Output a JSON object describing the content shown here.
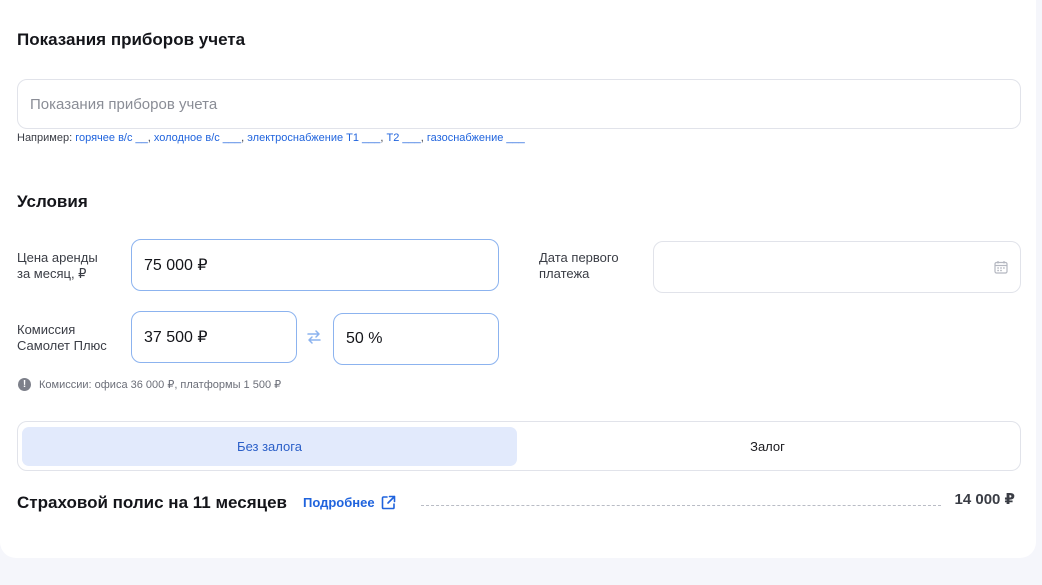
{
  "meters": {
    "title": "Показания приборов учета",
    "placeholder": "Показания приборов учета",
    "hint_prefix": "Например:",
    "hint_links": [
      "горячее в/с __",
      "холодное в/с ___",
      "электроснабжение Т1 ___",
      "Т2 ___",
      "газоснабжение ___"
    ]
  },
  "conditions": {
    "title": "Условия",
    "rent_label_line1": "Цена аренды",
    "rent_label_line2": "за месяц, ₽",
    "rent_value": "75 000 ₽",
    "first_payment_label_line1": "Дата первого",
    "first_payment_label_line2": "платежа",
    "first_payment_value": "",
    "commission_label_line1": "Комиссия",
    "commission_label_line2": "Самолет Плюс",
    "commission_amount": "37 500 ₽",
    "commission_percent": "50 %",
    "commission_info": "Комиссии: офиса 36 000 ₽, платформы 1 500 ₽"
  },
  "deposit_toggle": {
    "options": [
      "Без залога",
      "Залог"
    ],
    "selected": "Без залога"
  },
  "insurance": {
    "title": "Страховой полис на 11 месяцев",
    "more_label": "Подробнее",
    "price": "14 000 ₽"
  },
  "colors": {
    "accent": "#1f63dd",
    "active_segment_bg": "#e2eafc",
    "field_border_focus": "#8cb3ef"
  }
}
